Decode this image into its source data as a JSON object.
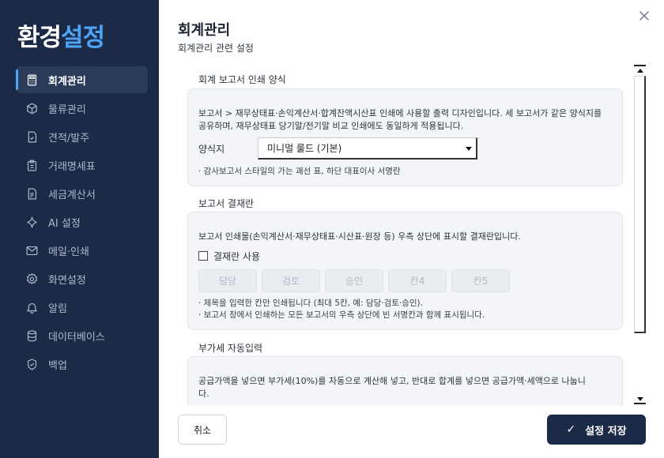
{
  "app": {
    "title_main": "환경",
    "title_accent": "설정"
  },
  "colors": {
    "sidebar_bg": "#1b2a47",
    "accent": "#4fa3f5",
    "active_item_bg": "#2b3b5a",
    "save_button_bg": "#1b2a47"
  },
  "sidebar": {
    "items": [
      {
        "label": "회계관리",
        "icon": "calculator-icon",
        "active": true
      },
      {
        "label": "물류관리",
        "icon": "box-icon",
        "active": false
      },
      {
        "label": "견적/발주",
        "icon": "document-check-icon",
        "active": false
      },
      {
        "label": "거래명세표",
        "icon": "clipboard-icon",
        "active": false
      },
      {
        "label": "세금계산서",
        "icon": "invoice-icon",
        "active": false
      },
      {
        "label": "AI 설정",
        "icon": "sparkle-icon",
        "active": false
      },
      {
        "label": "메일·인쇄",
        "icon": "mail-icon",
        "active": false
      },
      {
        "label": "화면설정",
        "icon": "gear-icon",
        "active": false
      },
      {
        "label": "알림",
        "icon": "bell-icon",
        "active": false
      },
      {
        "label": "데이터베이스",
        "icon": "database-icon",
        "active": false
      },
      {
        "label": "백업",
        "icon": "shield-check-icon",
        "active": false
      }
    ]
  },
  "header": {
    "title": "회계관리",
    "subtitle": "회계관리 관련 설정"
  },
  "sections": {
    "print_style": {
      "title": "회계 보고서 인쇄 양식",
      "description": "보고서 > 재무상태표·손익계산서·합계잔액시산표 인쇄에 사용할 출력 디자인입니다. 세 보고서가 같은 양식지를 공유하며, 재무상태표 당기말/전기말 비교 인쇄에도 동일하게 적용됩니다.",
      "form_label": "양식지",
      "form_value": "미니멀 룰드 (기본)",
      "note": "· 감사보고서 스타일의 가는 괘선 표, 하단 대표이사 서명란"
    },
    "approval": {
      "title": "보고서 결재란",
      "description": "보고서 인쇄물(손익계산서·재무상태표·시산표·원장 등) 우측 상단에 표시할 결재란입니다.",
      "checkbox_label": "결재란 사용",
      "checked": false,
      "slots": [
        "담당",
        "검토",
        "승인",
        "칸4",
        "칸5"
      ],
      "note1": "· 제목을 입력한 칸만 인쇄됩니다 (최대 5칸, 예: 담당·검토·승인).",
      "note2": "· 보고서 창에서 인쇄하는 모든 보고서의 우측 상단에 빈 서명칸과 함께 표시됩니다."
    },
    "vat": {
      "title": "부가세 자동입력",
      "description": "공급가액을 넣으면 부가세(10%)를 자동으로 계산해 넣고, 반대로 합계를 넣으면 공급가액·세액으로 나눕니다."
    }
  },
  "footer": {
    "cancel_label": "취소",
    "save_label": "설정 저장"
  }
}
